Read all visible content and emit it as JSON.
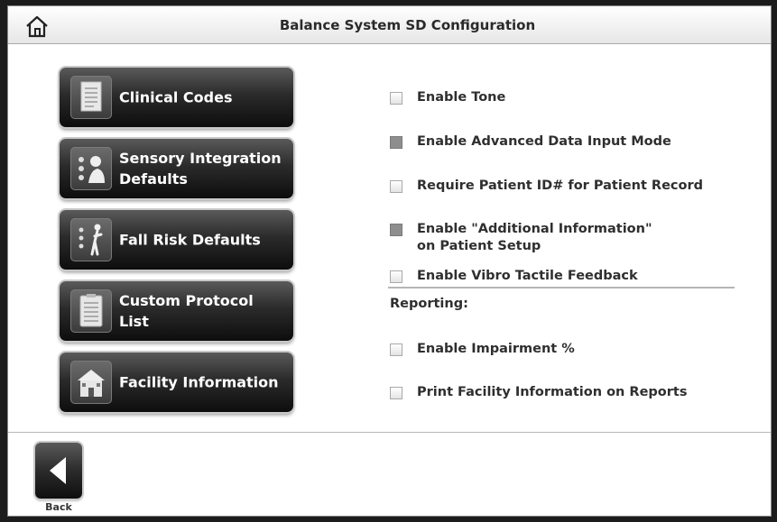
{
  "header": {
    "title": "Balance System SD Configuration",
    "home_icon": "home-icon"
  },
  "nav": [
    {
      "label": "Clinical Codes",
      "icon": "document-icon"
    },
    {
      "label": "Sensory Integration\nDefaults",
      "icon": "sensory-icon"
    },
    {
      "label": "Fall Risk Defaults",
      "icon": "fall-risk-icon"
    },
    {
      "label": "Custom Protocol\nList",
      "icon": "protocol-list-icon"
    },
    {
      "label": "Facility Information",
      "icon": "facility-icon"
    }
  ],
  "options": [
    {
      "label": "Enable Tone",
      "checked": false
    },
    {
      "label": "Enable Advanced Data Input Mode",
      "checked": true
    },
    {
      "label": "Require Patient ID# for Patient Record",
      "checked": false
    },
    {
      "label": "Enable \"Additional Information\"\non Patient Setup",
      "checked": true
    },
    {
      "label": "Enable Vibro Tactile Feedback",
      "checked": false
    }
  ],
  "reporting": {
    "heading": "Reporting:",
    "options": [
      {
        "label": "Enable Impairment %",
        "checked": false
      },
      {
        "label": "Print Facility Information on Reports",
        "checked": false
      }
    ]
  },
  "footer": {
    "back_label": "Back",
    "back_icon": "back-arrow-icon"
  }
}
